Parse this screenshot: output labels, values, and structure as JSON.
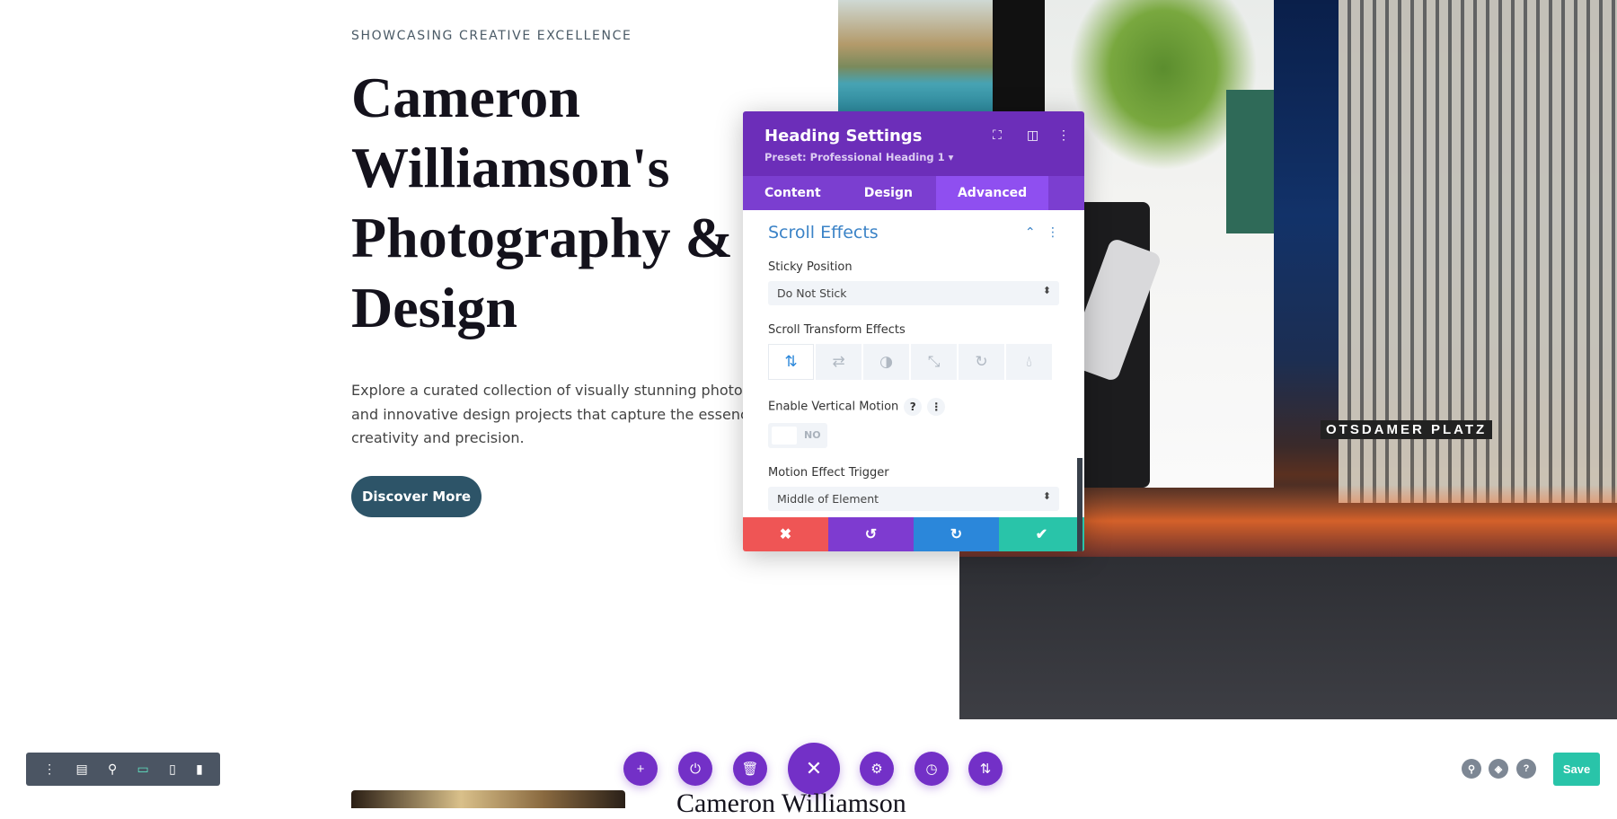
{
  "hero": {
    "eyebrow": "SHOWCASING CREATIVE EXCELLENCE",
    "title": "Cameron Williamson's Photography & Design",
    "description": [
      "Explore a curated collection of visually stunning photography",
      "and innovative design projects that capture the essence of",
      "creativity and precision."
    ],
    "cta_label": "Discover More",
    "image_sign_text": "OTSDAMER PLATZ"
  },
  "panel": {
    "title": "Heading Settings",
    "preset": "Preset: Professional Heading 1 ▾",
    "tabs": [
      {
        "label": "Content"
      },
      {
        "label": "Design"
      },
      {
        "label": "Advanced",
        "active": true
      }
    ],
    "section_title": "Scroll Effects",
    "sticky_label": "Sticky Position",
    "sticky_value": "Do Not Stick",
    "transform_label": "Scroll Transform Effects",
    "transform_icons": [
      "vertical-motion-icon",
      "horizontal-motion-icon",
      "fade-icon",
      "scale-icon",
      "rotate-icon",
      "blur-icon"
    ],
    "vertical_label": "Enable Vertical Motion",
    "vertical_toggle": "NO",
    "trigger_label": "Motion Effect Trigger",
    "trigger_value": "Middle of Element",
    "colors": {
      "header": "#6c2eb9",
      "cancel": "#ef5555",
      "undo": "#7e3bd0",
      "redo": "#2b87da",
      "save": "#29c4a9"
    }
  },
  "toolbar": {
    "save_label": "Save",
    "help": "?"
  },
  "below": {
    "name": "Cameron Williamson"
  }
}
